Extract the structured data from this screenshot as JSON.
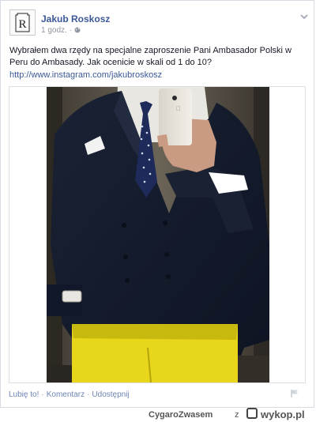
{
  "post": {
    "author": "Jakub Roskosz",
    "avatar_letter": "R",
    "time": "1 godz.",
    "privacy_icon": "globe-icon",
    "text": "Wybrałem dwa rzędy na specjalne zaproszenie Pani Ambasador Polski w Peru do Ambasady. Jak ocenicie w skali od 1 do 10?",
    "link": "http://www.instagram.com/jakubroskosz",
    "actions": {
      "like": "Lubię to!",
      "comment": "Komentarz",
      "share": "Udostępnij"
    },
    "colors": {
      "link": "#3b5998",
      "action": "#6d84b4",
      "muted": "#9197a3"
    }
  },
  "watermark": {
    "user": "CygaroZwasem",
    "connector": "z",
    "brand": "wykop.pl"
  }
}
